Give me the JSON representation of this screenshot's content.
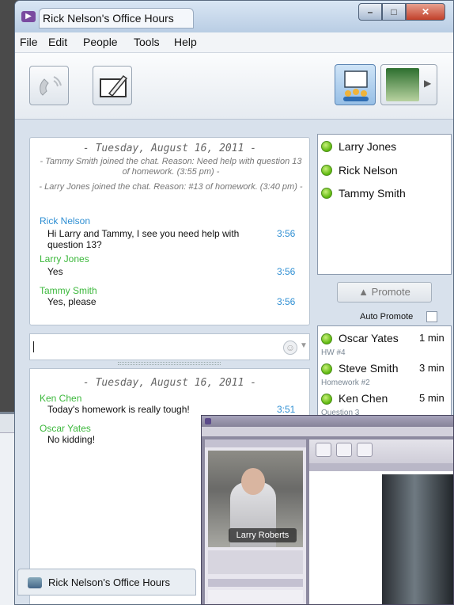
{
  "window": {
    "title": "Rick Nelson's Office Hours"
  },
  "menu": [
    "File",
    "Edit",
    "People",
    "Tools",
    "Help"
  ],
  "toolbar": {
    "icons": [
      "phone-icon",
      "whiteboard-icon",
      "room-icon",
      "webcam-icon"
    ]
  },
  "chat": {
    "date": "- Tuesday, August 16, 2011 -",
    "system": [
      "- Tammy Smith joined the chat.  Reason: Need help with question 13 of homework. (3:55 pm)  -",
      "- Larry Jones joined the chat.  Reason: #13 of homework. (3:40 pm)  -"
    ],
    "messages": [
      {
        "sender": "Rick Nelson",
        "text": "Hi Larry and Tammy, I see you need help with question 13?",
        "time": "3:56",
        "color": "#2f8fd3"
      },
      {
        "sender": "Larry Jones",
        "text": "Yes",
        "time": "3:56",
        "color": "#3cb83c"
      },
      {
        "sender": "Tammy Smith",
        "text": "Yes, please",
        "time": "3:56",
        "color": "#3cb83c"
      }
    ]
  },
  "input": {
    "value": ""
  },
  "lower_chat": {
    "date": "- Tuesday, August 16, 2011 -",
    "messages": [
      {
        "sender": "Ken Chen",
        "text": "Today's homework is really tough!",
        "time": "3:51",
        "color": "#3cb83c"
      },
      {
        "sender": "Oscar Yates",
        "text": "No kidding!",
        "time": "",
        "color": "#3cb83c"
      }
    ]
  },
  "participants": [
    "Larry Jones",
    "Rick Nelson",
    "Tammy Smith"
  ],
  "promote": {
    "label": "Promote",
    "auto_label": "Auto Promote"
  },
  "queue": [
    {
      "name": "Oscar Yates",
      "time": "1 min",
      "reason": "HW #4"
    },
    {
      "name": "Steve Smith",
      "time": "3 min",
      "reason": "Homework #2"
    },
    {
      "name": "Ken Chen",
      "time": "5 min",
      "reason": "Question 3"
    }
  ],
  "taskbar": {
    "tab_label": "Rick Nelson's Office Hours"
  },
  "overlay": {
    "nameplate": "Larry Roberts"
  },
  "colors": {
    "accent": "#2f8fd3",
    "online": "#5cb70c",
    "chrome": "#c8d6e8"
  }
}
